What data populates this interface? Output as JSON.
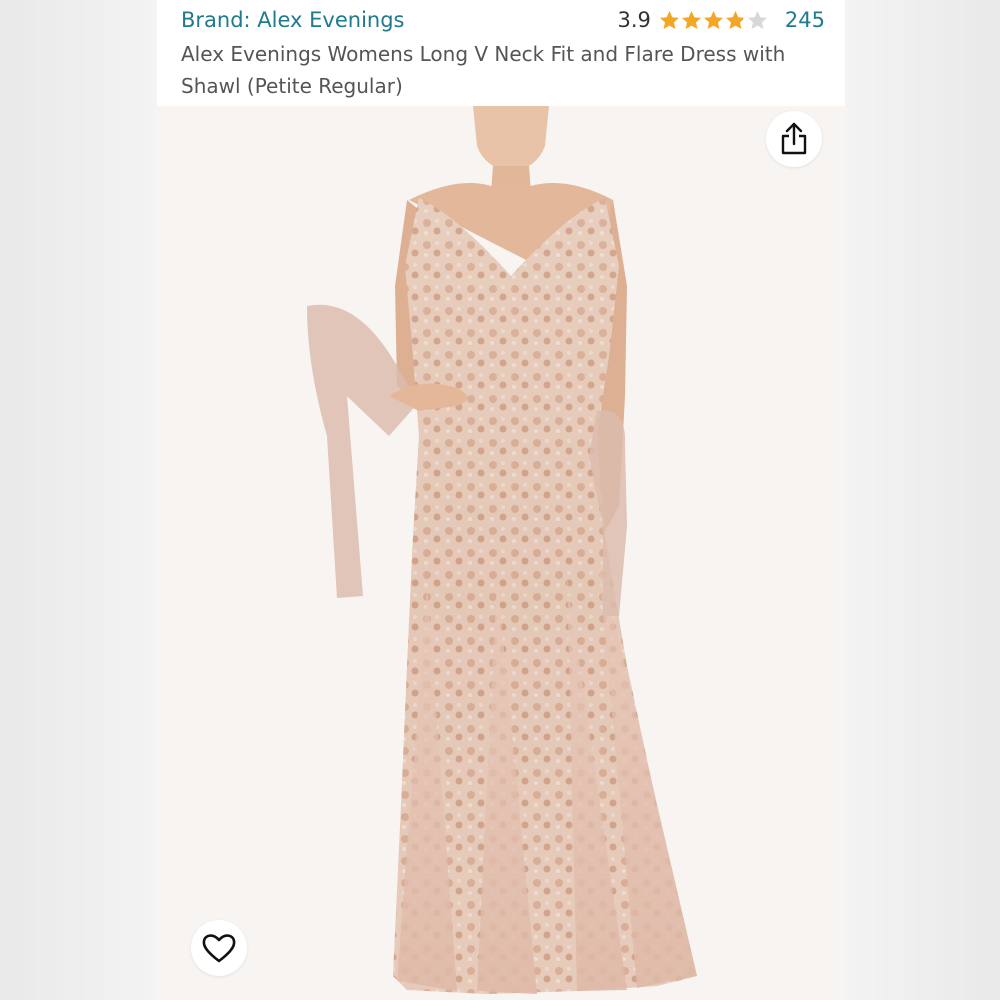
{
  "product": {
    "brand_label": "Brand: Alex Evenings",
    "rating_value": "3.9",
    "rating_stars": 3.9,
    "review_count": "245",
    "title": "Alex Evenings Womens Long V Neck Fit and Flare Dress with Shawl (Petite Regular)"
  },
  "image": {
    "subject": "model-wearing-blush-lace-gown-icon"
  },
  "actions": {
    "share_icon": "share-icon",
    "favorite_icon": "heart-icon"
  },
  "colors": {
    "brand_link": "#1f7a8c",
    "star_fill": "#f5a623",
    "star_empty": "#d8d8d8",
    "dress_blush": "#e8c7b6"
  }
}
